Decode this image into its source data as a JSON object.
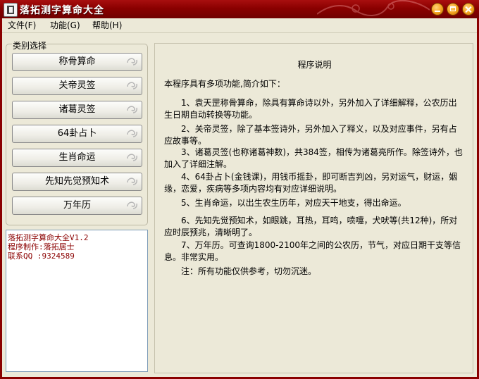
{
  "window": {
    "title": "落拓测字算命大全"
  },
  "menu": {
    "items": [
      "文件(F)",
      "功能(G)",
      "帮助(H)"
    ]
  },
  "sidebar": {
    "group_label": "类别选择",
    "buttons": [
      "称骨算命",
      "关帝灵签",
      "诸葛灵签",
      "64卦占卜",
      "生肖命运",
      "先知先觉预知术",
      "万年历"
    ]
  },
  "info": {
    "lines": [
      "落拓测字算命大全V1.2",
      "程序制作:落拓居士",
      "联系QQ :9324589"
    ]
  },
  "content": {
    "title": "程序说明",
    "intro": "本程序具有多项功能,简介如下：",
    "paragraphs": [
      "1、袁天罡称骨算命，除具有算命诗以外，另外加入了详细解释，公农历出生日期自动转换等功能。",
      "2、关帝灵签，除了基本签诗外，另外加入了释义，以及对应事件，另有占应故事等。",
      "3、诸葛灵签(也称诸葛神数)，共384签，相传为诸葛亮所作。除签诗外，也加入了详细注解。",
      "4、64卦占卜(金钱课)，用钱币摇卦，即可断吉判凶，另对运气，财运，姻缘，恋爱，疾病等多项内容均有对应详细说明。",
      "5、生肖命运，以出生农生历年，对应天干地支，得出命运。",
      "6、先知先觉预知术，如眼跳，耳热，耳鸣，喷嚏，犬吠等(共12种)，所对应时辰预兆，清晰明了。",
      "7、万年历。可查询1800-2100年之间的公农历，节气，对应日期干支等信息。非常实用。",
      "注：所有功能仅供参考，切勿沉迷。"
    ]
  },
  "colors": {
    "titlebar": "#8a0000",
    "info_text": "#8b0000",
    "window_bg": "#ece9d8"
  }
}
